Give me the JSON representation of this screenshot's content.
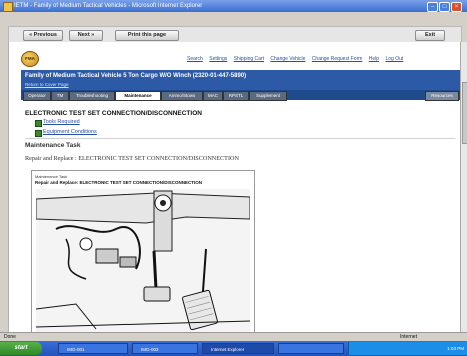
{
  "window": {
    "title": "IETM - Family of Medium Tactical Vehicles - Microsoft Internet Explorer"
  },
  "toolbar": {
    "previous_label": "« Previous",
    "next_label": "Next »",
    "print_label": "Print this page",
    "exit_label": "Exit"
  },
  "header": {
    "logo_text": "FMA",
    "links": [
      "Search",
      "Settings",
      "Shipping Cart",
      "Change Vehicle",
      "Change Request Form",
      "Help",
      "Log Out"
    ]
  },
  "vehicle": {
    "title": "Family of Medium Tactical Vehicle 5 Ton Cargo W/O Winch (2320-01-447-5890)",
    "return_link": "Return to Cover Page"
  },
  "tabs": [
    {
      "label": "Operator"
    },
    {
      "label": "TM"
    },
    {
      "label": "Troubleshooting"
    },
    {
      "label": "Maintenance"
    },
    {
      "label": "Ammo/Stows"
    },
    {
      "label": "MAC"
    },
    {
      "label": "RPSTL"
    },
    {
      "label": "Supplement"
    }
  ],
  "active_tab": "Maintenance",
  "right_tab": "Resources",
  "content": {
    "heading": "ELECTRONIC TEST SET CONNECTION/DISCONNECTION",
    "links": [
      "Tools Required",
      "Equipment Conditions"
    ],
    "section_title": "Maintenance Task",
    "subtitle": "Repair and Replace : ELECTRONIC TEST SET CONNECTION/DISCONNECTION"
  },
  "figure": {
    "caption1": "Maintenance Task",
    "caption2": "Repair and Replace: ELECTRONIC TEST SET CONNECTION/DISCONNECTION"
  },
  "status": {
    "left": "Done",
    "right": "Internet"
  },
  "taskbar": {
    "start_label": "start",
    "items": [
      {
        "label": "IMG-001"
      },
      {
        "label": "IMG-002"
      },
      {
        "label": "Internet Explorer"
      },
      {
        "label": ""
      }
    ],
    "clock": "1:03 PM"
  },
  "colors": {
    "vehicle_bar": "#2d5aa6",
    "tab_bar": "#1f4a8c",
    "link": "#2a4fa8"
  }
}
